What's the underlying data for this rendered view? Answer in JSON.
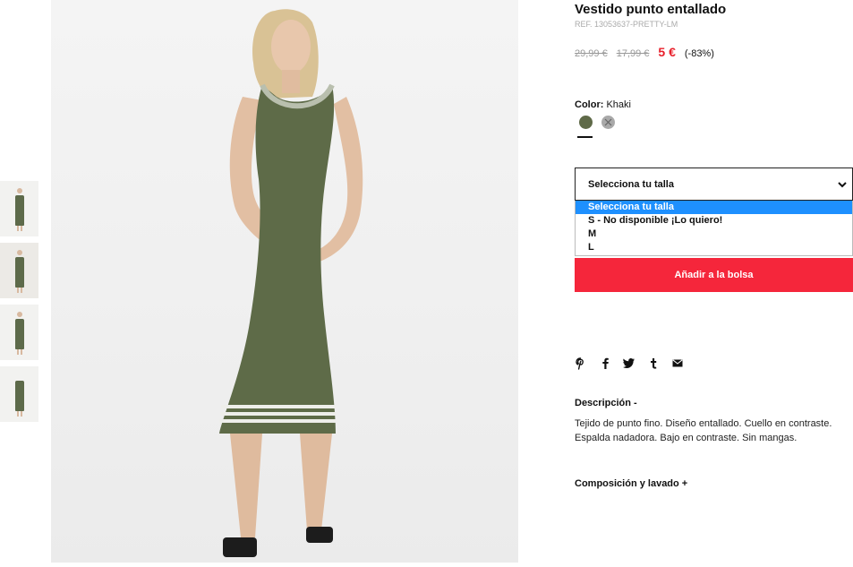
{
  "product": {
    "title": "Vestido punto entallado",
    "ref": "REF. 13053637-PRETTY-LM",
    "price_original": "29,99 €",
    "price_previous": "17,99 €",
    "price_current": "5 €",
    "discount": "(-83%)",
    "color_label": "Color:",
    "color_value": "Khaki"
  },
  "size_select": {
    "label": "Selecciona tu talla",
    "options": [
      "Selecciona tu talla",
      "S - No disponible ¡Lo quiero!",
      "M",
      "L"
    ],
    "highlighted_index": 0
  },
  "add_to_bag_label": "Añadir a la bolsa",
  "share_icons": [
    "pinterest-icon",
    "facebook-icon",
    "twitter-icon",
    "tumblr-icon",
    "mail-icon"
  ],
  "description": {
    "title": "Descripción -",
    "text": "Tejido de punto fino. Diseño entallado. Cuello en contraste. Espalda nadadora. Bajo en contraste. Sin mangas."
  },
  "composition_title": "Composición y lavado +",
  "colors": {
    "accent": "#f5263b",
    "price": "#e8202b",
    "khaki_swatch": "#5f6a48",
    "grey_swatch": "#a9a9a9",
    "dropdown_highlight": "#1e90ff"
  }
}
